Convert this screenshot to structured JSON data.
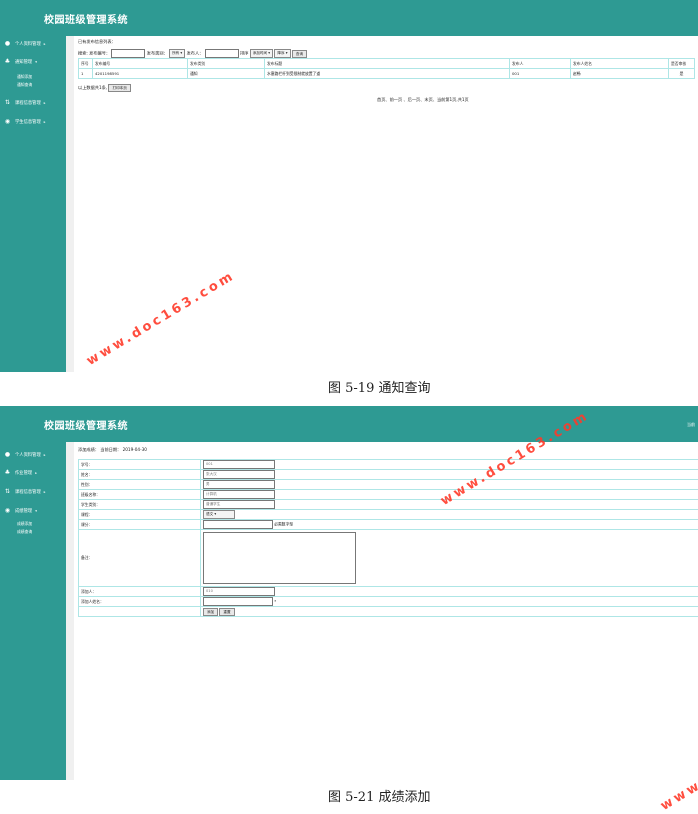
{
  "app_title": "校园班级管理系统",
  "screen1": {
    "sidebar": [
      {
        "label": "个人资料管理",
        "icon": "user-icon"
      },
      {
        "label": "通知管理",
        "icon": "users-icon"
      },
      {
        "label": "课程信息管理",
        "icon": "book-icon"
      },
      {
        "label": "学生信息管理",
        "icon": "student-icon"
      }
    ],
    "sub_items": [
      "通知添加",
      "通知查询"
    ],
    "list_title": "已有发布信息列表：",
    "search": {
      "label": "搜索:",
      "code_label": "发布编号：",
      "type_label": "发布类别：",
      "type_value": "所有",
      "publisher_label": "发布人：",
      "sort_label": "排序",
      "sort_field": "添加时间",
      "sort_order": "降序",
      "query_button": "查询"
    },
    "columns": [
      "序号",
      "发布编号",
      "发布类别",
      "发布标题",
      "发布人",
      "发布人姓名",
      "是否审核"
    ],
    "rows": [
      [
        "1",
        "4201198591",
        "通知",
        "水塞路栏杆到受限制就放置了道",
        "001",
        "赵畅",
        "是"
      ]
    ],
    "count_text": "以上数据共1条,",
    "print_button": "打印本页",
    "pager": "首页、前一页 、后一页、末页、当前第1页,共1页",
    "caption": "图 5-19 通知查询"
  },
  "screen2": {
    "top_right": "当前",
    "sidebar": [
      {
        "label": "个人资料管理",
        "icon": "user-icon"
      },
      {
        "label": "作业管理",
        "icon": "users-icon"
      },
      {
        "label": "课程信息管理",
        "icon": "book-icon"
      },
      {
        "label": "成绩管理",
        "icon": "grade-icon"
      }
    ],
    "sub_items": [
      "成绩添加",
      "成绩查询"
    ],
    "header_label": "添加成绩：",
    "date_label": "当前日期：",
    "date_value": "2019-04-30",
    "fields": [
      {
        "label": "学号：",
        "value": "001"
      },
      {
        "label": "姓名：",
        "value": "张大汉"
      },
      {
        "label": "性别：",
        "value": "男"
      },
      {
        "label": "班级名称：",
        "value": "计算机"
      },
      {
        "label": "学生类别：",
        "value": "普通学生"
      }
    ],
    "course_label": "课程：",
    "course_value": "语文",
    "score_label": "课分：",
    "score_hint": "必需数字型",
    "remark_label": "备注：",
    "adder_label": "添加人：",
    "adder_value": "010",
    "adder_name_label": "添加人姓名：",
    "adder_name_mark": "*",
    "add_button": "添加",
    "reset_button": "重置",
    "caption": "图 5-21 成绩添加"
  },
  "watermark": "www.doc163.com"
}
